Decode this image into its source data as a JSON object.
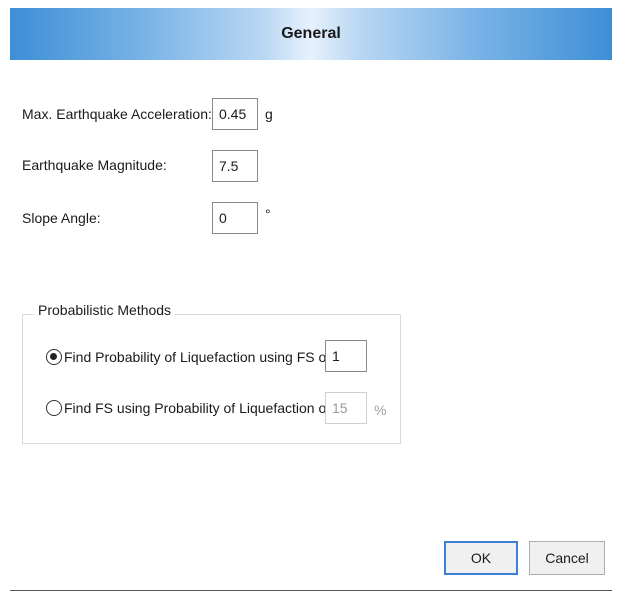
{
  "dialog": {
    "title": "General"
  },
  "fields": {
    "max_acceleration": {
      "label": "Max. Earthquake Acceleration:",
      "value": "0.45",
      "unit": "g"
    },
    "magnitude": {
      "label": "Earthquake Magnitude:",
      "value": "7.5"
    },
    "slope_angle": {
      "label": "Slope Angle:",
      "value": "0",
      "unit": "°"
    }
  },
  "probabilistic": {
    "group_title": "Probabilistic Methods",
    "options": [
      {
        "label": "Find Probability of Liquefaction using FS of",
        "value": "1",
        "unit": "",
        "selected": true,
        "enabled": true
      },
      {
        "label": "Find FS using Probability of Liquefaction of",
        "value": "15",
        "unit": "%",
        "selected": false,
        "enabled": false
      }
    ]
  },
  "buttons": {
    "ok": "OK",
    "cancel": "Cancel"
  },
  "colors": {
    "header_gradient_edge": "#3d8fd6",
    "header_gradient_center": "#e6f1fc",
    "default_button_border": "#3c7fd6"
  }
}
